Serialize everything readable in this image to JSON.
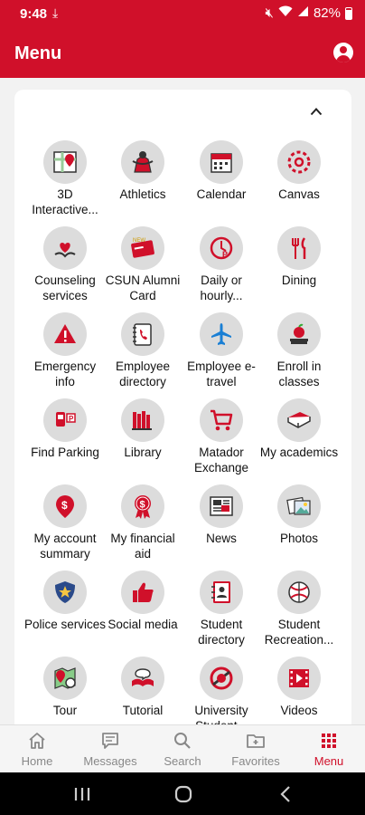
{
  "status_bar": {
    "time": "9:48",
    "battery": "82%"
  },
  "app_bar": {
    "title": "Menu"
  },
  "menu_items": [
    {
      "label": "3D Interactive...",
      "icon": "map-3d-icon"
    },
    {
      "label": "Athletics",
      "icon": "matador-icon"
    },
    {
      "label": "Calendar",
      "icon": "calendar-icon"
    },
    {
      "label": "Canvas",
      "icon": "canvas-icon"
    },
    {
      "label": "Counseling services",
      "icon": "heart-hands-icon"
    },
    {
      "label": "CSUN Alumni Card",
      "icon": "alumni-card-icon"
    },
    {
      "label": "Daily or hourly...",
      "icon": "parking-clock-icon"
    },
    {
      "label": "Dining",
      "icon": "utensils-icon"
    },
    {
      "label": "Emergency info",
      "icon": "warning-icon"
    },
    {
      "label": "Employee directory",
      "icon": "phone-book-icon"
    },
    {
      "label": "Employee e-travel",
      "icon": "airplane-icon"
    },
    {
      "label": "Enroll in classes",
      "icon": "apple-books-icon"
    },
    {
      "label": "Find Parking",
      "icon": "parking-meter-icon"
    },
    {
      "label": "Library",
      "icon": "library-icon"
    },
    {
      "label": "Matador Exchange",
      "icon": "shopping-cart-icon"
    },
    {
      "label": "My academics",
      "icon": "book-icon"
    },
    {
      "label": "My account summary",
      "icon": "dollar-pin-icon"
    },
    {
      "label": "My financial aid",
      "icon": "dollar-ribbon-icon"
    },
    {
      "label": "News",
      "icon": "newspaper-icon"
    },
    {
      "label": "Photos",
      "icon": "photos-icon"
    },
    {
      "label": "Police services",
      "icon": "police-badge-icon"
    },
    {
      "label": "Social media",
      "icon": "thumbs-up-icon"
    },
    {
      "label": "Student directory",
      "icon": "student-directory-icon"
    },
    {
      "label": "Student Recreation...",
      "icon": "recreation-icon"
    },
    {
      "label": "Tour",
      "icon": "tour-map-icon"
    },
    {
      "label": "Tutorial",
      "icon": "tutorial-icon"
    },
    {
      "label": "University Student...",
      "icon": "university-student-icon"
    },
    {
      "label": "Videos",
      "icon": "video-icon"
    }
  ],
  "bottom_nav": [
    {
      "label": "Home",
      "icon": "home-icon"
    },
    {
      "label": "Messages",
      "icon": "messages-icon"
    },
    {
      "label": "Search",
      "icon": "search-icon"
    },
    {
      "label": "Favorites",
      "icon": "favorites-folder-icon"
    },
    {
      "label": "Menu",
      "icon": "grid-menu-icon",
      "active": true
    }
  ],
  "colors": {
    "brand_red": "#d0102a",
    "icon_circle": "#dcdcdc",
    "nav_inactive": "#888888"
  }
}
